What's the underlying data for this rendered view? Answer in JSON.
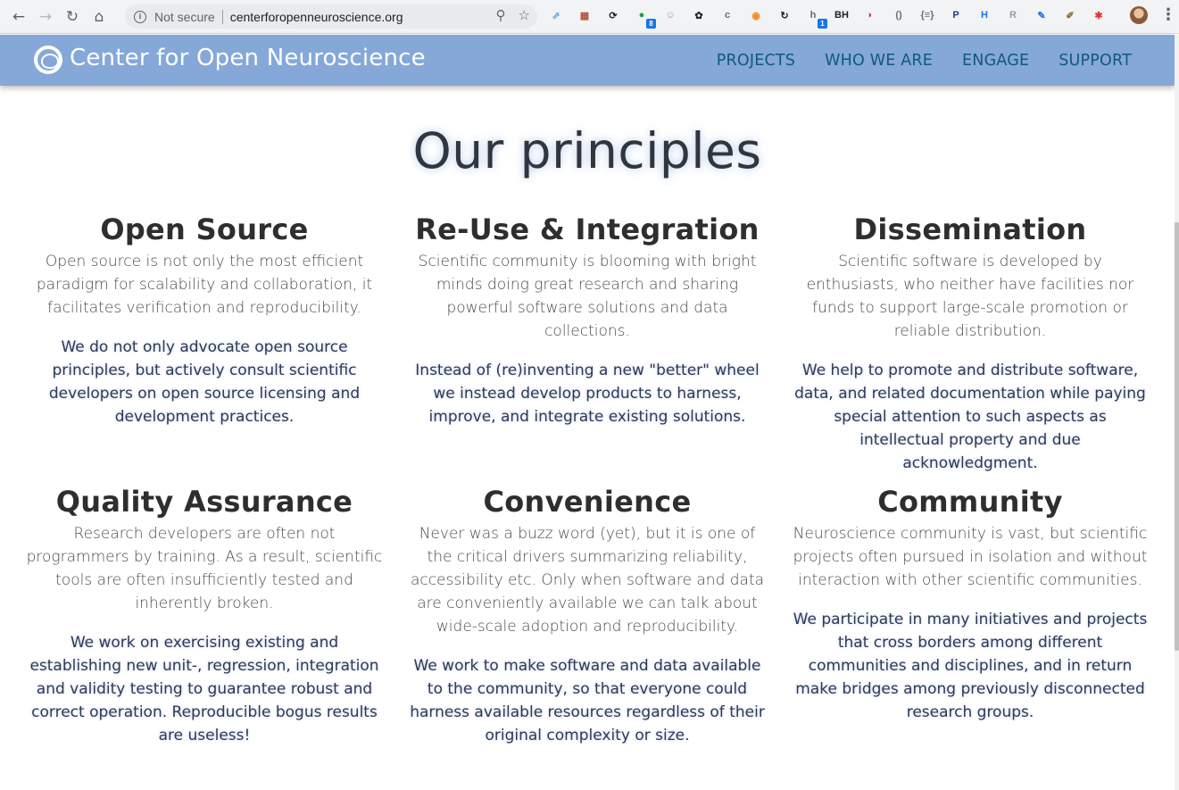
{
  "browser": {
    "security_label": "Not secure",
    "url": "centerforopenneuroscience.org",
    "extensions": [
      {
        "name": "tabs-icon",
        "color": "#5aa8e6",
        "glyph": "⇗",
        "badge": ""
      },
      {
        "name": "calendar-icon",
        "color": "#b0573c",
        "glyph": "▦",
        "badge": ""
      },
      {
        "name": "sync-icon",
        "color": "#202124",
        "glyph": "⟳",
        "badge": ""
      },
      {
        "name": "status-dot-icon",
        "color": "#1e9e4a",
        "glyph": "●",
        "badge": "8"
      },
      {
        "name": "smile-icon",
        "color": "#9e9e9e",
        "glyph": "☺",
        "badge": ""
      },
      {
        "name": "paw-icon",
        "color": "#202124",
        "glyph": "✿",
        "badge": ""
      },
      {
        "name": "c-icon",
        "color": "#6b6b6b",
        "glyph": "c",
        "badge": ""
      },
      {
        "name": "rss-icon",
        "color": "#f08a24",
        "glyph": "◉",
        "badge": ""
      },
      {
        "name": "circle-arrow-icon",
        "color": "#202124",
        "glyph": "↻",
        "badge": ""
      },
      {
        "name": "hk-icon",
        "color": "#6b6b6b",
        "glyph": "h",
        "badge": "1"
      },
      {
        "name": "bh-icon",
        "color": "#202124",
        "glyph": "BH",
        "badge": ""
      },
      {
        "name": "pocket-icon",
        "color": "#e0245e",
        "glyph": "◗",
        "badge": ""
      },
      {
        "name": "brackets-icon",
        "color": "#6b6b6b",
        "glyph": "()",
        "badge": ""
      },
      {
        "name": "json-icon",
        "color": "#6b6b6b",
        "glyph": "{≡}",
        "badge": ""
      },
      {
        "name": "paypal-icon",
        "color": "#253b80",
        "glyph": "P",
        "badge": ""
      },
      {
        "name": "h-icon",
        "color": "#1a73e8",
        "glyph": "H",
        "badge": ""
      },
      {
        "name": "r-icon",
        "color": "#9e9e9e",
        "glyph": "R",
        "badge": ""
      },
      {
        "name": "feather-icon",
        "color": "#1a73e8",
        "glyph": "✎",
        "badge": ""
      },
      {
        "name": "clipboard-icon",
        "color": "#8a6d3b",
        "glyph": "✐",
        "badge": ""
      },
      {
        "name": "asterisk-icon",
        "color": "#e53935",
        "glyph": "✱",
        "badge": ""
      }
    ]
  },
  "site": {
    "brand": "Center for Open Neuroscience",
    "nav": [
      "PROJECTS",
      "WHO WE ARE",
      "ENGAGE",
      "SUPPORT"
    ],
    "header_color": "#85a8d9",
    "nav_color": "#0f5a7a"
  },
  "main": {
    "heading": "Our principles",
    "principles": [
      {
        "title": "Open Source",
        "p1": "Open source is not only the most efficient paradigm for scalability and collaboration, it facilitates verification and reproducibility.",
        "p2": "We do not only advocate open source principles, but actively consult scientific developers on open source licensing and development practices."
      },
      {
        "title": "Re-Use & Integration",
        "p1": "Scientific community is blooming with bright minds doing great research and sharing powerful software solutions and data collections.",
        "p2": "Instead of (re)inventing a new \"better\" wheel we instead develop products to harness, improve, and integrate existing solutions."
      },
      {
        "title": "Dissemination",
        "p1": "Scientific software is developed by enthusiasts, who neither have facilities nor funds to support large-scale promotion or reliable distribution.",
        "p2": "We help to promote and distribute software, data, and related documentation while paying special attention to such aspects as intellectual property and due acknowledgment."
      },
      {
        "title": "Quality Assurance",
        "p1": "Research developers are often not programmers by training. As a result, scientific tools are often insufficiently tested and inherently broken.",
        "p2": "We work on exercising existing and establishing new unit-, regression, integration and validity testing to guarantee robust and correct operation. Reproducible bogus results are useless!"
      },
      {
        "title": "Convenience",
        "p1": "Never was a buzz word (yet), but it is one of the critical drivers summarizing reliability, accessibility etc. Only when software and data are conveniently available we can talk about wide-scale adoption and reproducibility.",
        "p2": "We work to make software and data available to the community, so that everyone could harness available resources regardless of their original complexity or size."
      },
      {
        "title": "Community",
        "p1": "Neuroscience community is vast, but scientific projects often pursued in isolation and without interaction with other scientific communities.",
        "p2": "We participate in many initiatives and projects that cross borders among different communities and disciplines, and in return make bridges among previously disconnected research groups."
      }
    ]
  }
}
